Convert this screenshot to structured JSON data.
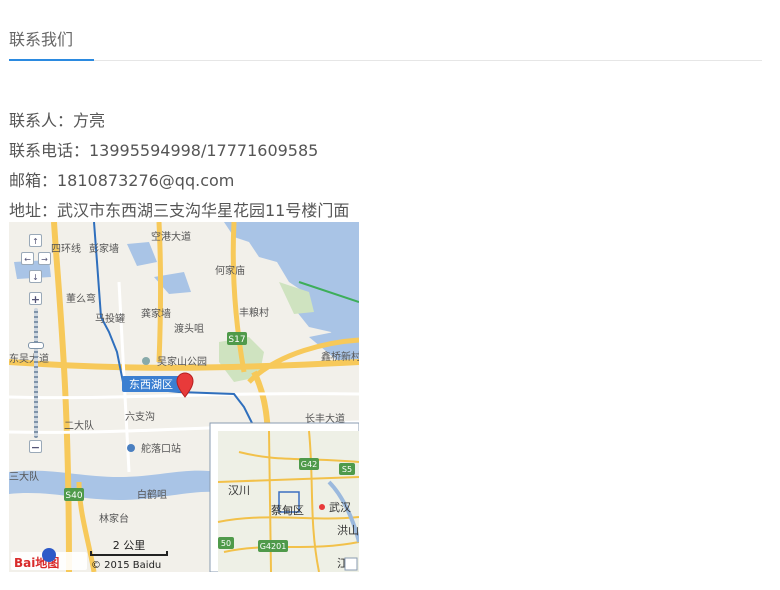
{
  "section": {
    "title": "联系我们"
  },
  "contact": {
    "person": "联系人：方亮",
    "phone": "联系电话：13995594998/17771609585",
    "email": "邮箱：1810873276@qq.com",
    "address": "地址：武汉市东西湖三支沟华星花园11号楼门面"
  },
  "map": {
    "place_labels": [
      "彭家墙",
      "何家庙",
      "董么弯",
      "马投罐",
      "龚家墙",
      "渡头咀",
      "丰粮村",
      "吴家山公园",
      "鑫桥新村",
      "六支沟",
      "二大队",
      "舵落口站",
      "白鹤咀",
      "林家台",
      "东吴大道",
      "四环线",
      "空港大道",
      "长丰大道",
      "三大队"
    ],
    "highway_badges": [
      "S17",
      "S40"
    ],
    "district_label": "东西湖区",
    "overview": {
      "labels": [
        "汉川",
        "蔡甸区",
        "武汉",
        "洪山",
        "江"
      ],
      "highway_badges": [
        "G42",
        "S5",
        "G4201",
        "50"
      ]
    },
    "scale_text": "2 公里",
    "copyright": "© 2015 Baidu",
    "logo_text": "Bai地图",
    "controls": {
      "up_icon": "arrow-up-icon",
      "down_icon": "arrow-down-icon",
      "left_icon": "arrow-left-icon",
      "right_icon": "arrow-right-icon",
      "zoom_in": "+",
      "zoom_out": "−"
    },
    "colors": {
      "water": "#a9c4e6",
      "land": "#f2f0ea",
      "major_road": "#f7c95a",
      "district_boundary": "#2f6fbd",
      "marker": "#e83a3a"
    }
  }
}
